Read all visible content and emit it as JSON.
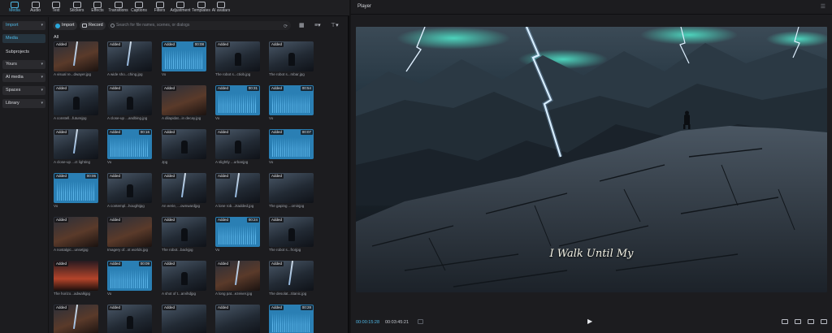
{
  "toolbar": {
    "items": [
      {
        "label": "Media",
        "icon": "media-icon",
        "active": true
      },
      {
        "label": "Audio",
        "icon": "audio-icon"
      },
      {
        "label": "Text",
        "icon": "text-icon"
      },
      {
        "label": "Stickers",
        "icon": "stickers-icon"
      },
      {
        "label": "Effects",
        "icon": "effects-icon"
      },
      {
        "label": "Transitions",
        "icon": "transitions-icon"
      },
      {
        "label": "Captions",
        "icon": "captions-icon"
      },
      {
        "label": "Filters",
        "icon": "filters-icon"
      },
      {
        "label": "Adjustment",
        "icon": "adjustment-icon"
      },
      {
        "label": "Templates",
        "icon": "templates-icon"
      },
      {
        "label": "AI avatars",
        "icon": "ai-avatars-icon"
      }
    ]
  },
  "sidebar": {
    "items": [
      {
        "label": "Import",
        "box": true,
        "chevron": true,
        "selected": true
      },
      {
        "label": "Media",
        "box": false,
        "selected": true
      },
      {
        "label": "Subprojects",
        "box": false
      },
      {
        "label": "Yours",
        "box": true,
        "chevron": true
      },
      {
        "label": "AI media",
        "box": true,
        "chevron": true
      },
      {
        "label": "Spaces",
        "box": true,
        "chevron": true
      },
      {
        "label": "Library",
        "box": true,
        "chevron": true
      }
    ]
  },
  "media": {
    "import_label": "Import",
    "record_label": "Record",
    "search_placeholder": "Search for file names, scenes, or dialogs",
    "all_label": "All",
    "badge": "Added",
    "tiles": [
      {
        "cap": "A visual re...dwayer.jpg",
        "kind": "bolt-warm"
      },
      {
        "cap": "A wide sho...ching.jpg",
        "kind": "bolt"
      },
      {
        "cap": "Vo",
        "kind": "audio",
        "dur": "00:08"
      },
      {
        "cap": "The robot s...ctiob.jpg",
        "kind": "fig"
      },
      {
        "cap": "The robot s...mbar.jpg",
        "kind": "fig"
      },
      {
        "cap": "A constell...futurejpg",
        "kind": "fig"
      },
      {
        "cap": "A close-up ...andbing.jpg",
        "kind": "fig"
      },
      {
        "cap": "A dilapidat...in decay.jpg",
        "kind": "warm"
      },
      {
        "cap": "Vo",
        "kind": "audio",
        "dur": "00:31"
      },
      {
        "cap": "Vo",
        "kind": "audio",
        "dur": "00:54"
      },
      {
        "cap": "A close-up ...ct lighting",
        "kind": "bolt"
      },
      {
        "cap": "Vo",
        "kind": "audio",
        "dur": "00:16"
      },
      {
        "cap": "Jpg",
        "kind": "fig"
      },
      {
        "cap": "A slightly ...urbanjpg",
        "kind": "fig"
      },
      {
        "cap": "Vo",
        "kind": "audio",
        "dur": "00:07"
      },
      {
        "cap": "Vo",
        "kind": "audio",
        "dur": "00:06"
      },
      {
        "cap": "A contempl...houghtjpg",
        "kind": "fig"
      },
      {
        "cap": "An eerie, ...ownwardjpg",
        "kind": "bolt"
      },
      {
        "cap": "A lone rob...ztadded.jpg",
        "kind": "bolt"
      },
      {
        "cap": "The gaping ...ominjpg",
        "kind": "plain"
      },
      {
        "cap": "A nostalgic...unsetjpg",
        "kind": "warm"
      },
      {
        "cap": "Imagery of...st worlds.jpg",
        "kind": "warm"
      },
      {
        "cap": "The robot...backjpg",
        "kind": "fig"
      },
      {
        "cap": "Vo",
        "kind": "audio",
        "dur": "00:24"
      },
      {
        "cap": "The robot s...frorjpg",
        "kind": "fig"
      },
      {
        "cap": "The horizo...adwalkjpg",
        "kind": "fire"
      },
      {
        "cap": "Vo",
        "kind": "audio",
        "dur": "00:09"
      },
      {
        "cap": "A shot of t...arvihdjpg",
        "kind": "fig"
      },
      {
        "cap": "A long pat...ezeiver.jpg",
        "kind": "bolt-warm"
      },
      {
        "cap": "The desolat...titanic.jpg",
        "kind": "bolt"
      },
      {
        "cap": "",
        "kind": "bolt-warm"
      },
      {
        "cap": "",
        "kind": "fig"
      },
      {
        "cap": "",
        "kind": "plain"
      },
      {
        "cap": "",
        "kind": "plain"
      },
      {
        "cap": "",
        "kind": "audio",
        "dur": "00:28"
      }
    ]
  },
  "player": {
    "title": "Player",
    "caption": "I Walk Until My",
    "time_current": "00:00:15:28",
    "time_total": "00:03:45:21",
    "colors": {
      "accent": "#4fb8e6",
      "lightning_glow": "#4fe3c8"
    }
  }
}
